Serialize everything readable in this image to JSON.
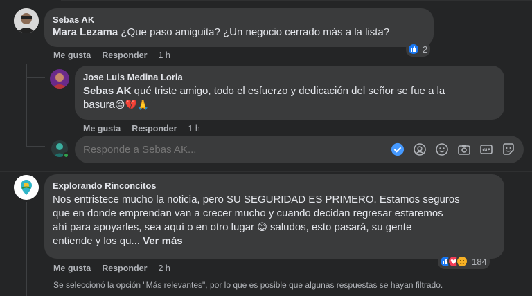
{
  "comments": [
    {
      "author": "Sebas AK",
      "mention": "Mara Lezama",
      "text": " ¿Que paso amiguita? ¿Un negocio cerrado más a la lista?",
      "like_label": "Me gusta",
      "reply_label": "Responder",
      "time": "1 h",
      "reaction_count": "2"
    },
    {
      "author": "Jose Luis Medina Loria",
      "mention": "Sebas AK",
      "text_line1": " qué triste amigo, todo el esfuerzo y dedicación del señor se fue a la",
      "text_line2": "basura",
      "emojis": "😔💔🙏",
      "like_label": "Me gusta",
      "reply_label": "Responder",
      "time": "1 h"
    },
    {
      "author": "Explorando Rinconcitos",
      "lines": [
        "Nos entristece mucho la noticia, pero SU SEGURIDAD ES PRIMERO. Estamos seguros",
        "que en donde emprendan van a crecer mucho y cuando decidan regresar estaremos",
        "ahí para apoyarles, sea aquí o en otro lugar",
        " saludos, esto pasará, su gente",
        "entiende y los qu... "
      ],
      "emoji": "😊",
      "see_more": "Ver más",
      "like_label": "Me gusta",
      "reply_label": "Responder",
      "time": "2 h",
      "reaction_count": "184"
    }
  ],
  "reply_box": {
    "placeholder": "Responde a Sebas AK..."
  },
  "footer_note": "Se seleccionó la opción \"Más relevantes\", por lo que es posible que algunas respuestas se hayan filtrado.",
  "colors": {
    "background": "#242526",
    "bubble": "#3a3b3c",
    "like": "#1877f2",
    "heart": "#f33e58",
    "sad": "#f7b125",
    "check": "#4599ff"
  }
}
